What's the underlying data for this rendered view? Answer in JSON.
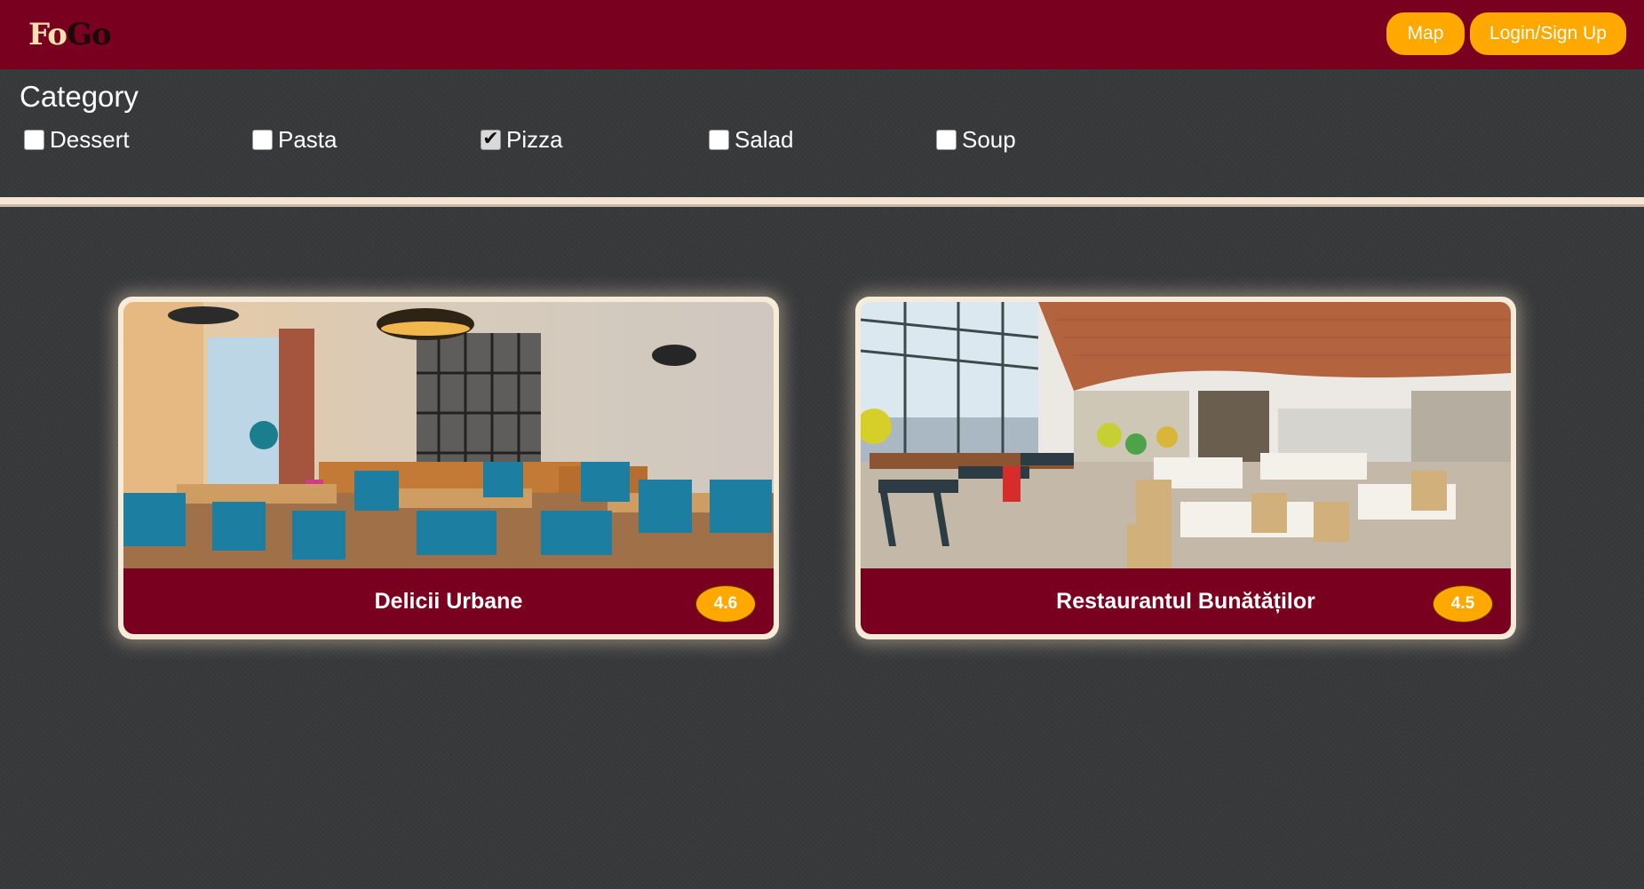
{
  "header": {
    "logo_part1": "Fo",
    "logo_part2": "Go",
    "map_label": "Map",
    "login_label": "Login/Sign Up"
  },
  "filters": {
    "title": "Category",
    "items": [
      {
        "label": "Dessert",
        "checked": false
      },
      {
        "label": "Pasta",
        "checked": false
      },
      {
        "label": "Pizza",
        "checked": true
      },
      {
        "label": "Salad",
        "checked": false
      },
      {
        "label": "Soup",
        "checked": false
      }
    ]
  },
  "restaurants": [
    {
      "name": "Delicii Urbane",
      "rating": "4.6",
      "image": "restaurant-interior-photo"
    },
    {
      "name": "Restaurantul Bunătăților",
      "rating": "4.5",
      "image": "restaurant-interior-photo"
    }
  ],
  "colors": {
    "brand": "#7a0020",
    "accent": "#ffa800",
    "cream": "#f6ead8",
    "background": "#38393b"
  }
}
